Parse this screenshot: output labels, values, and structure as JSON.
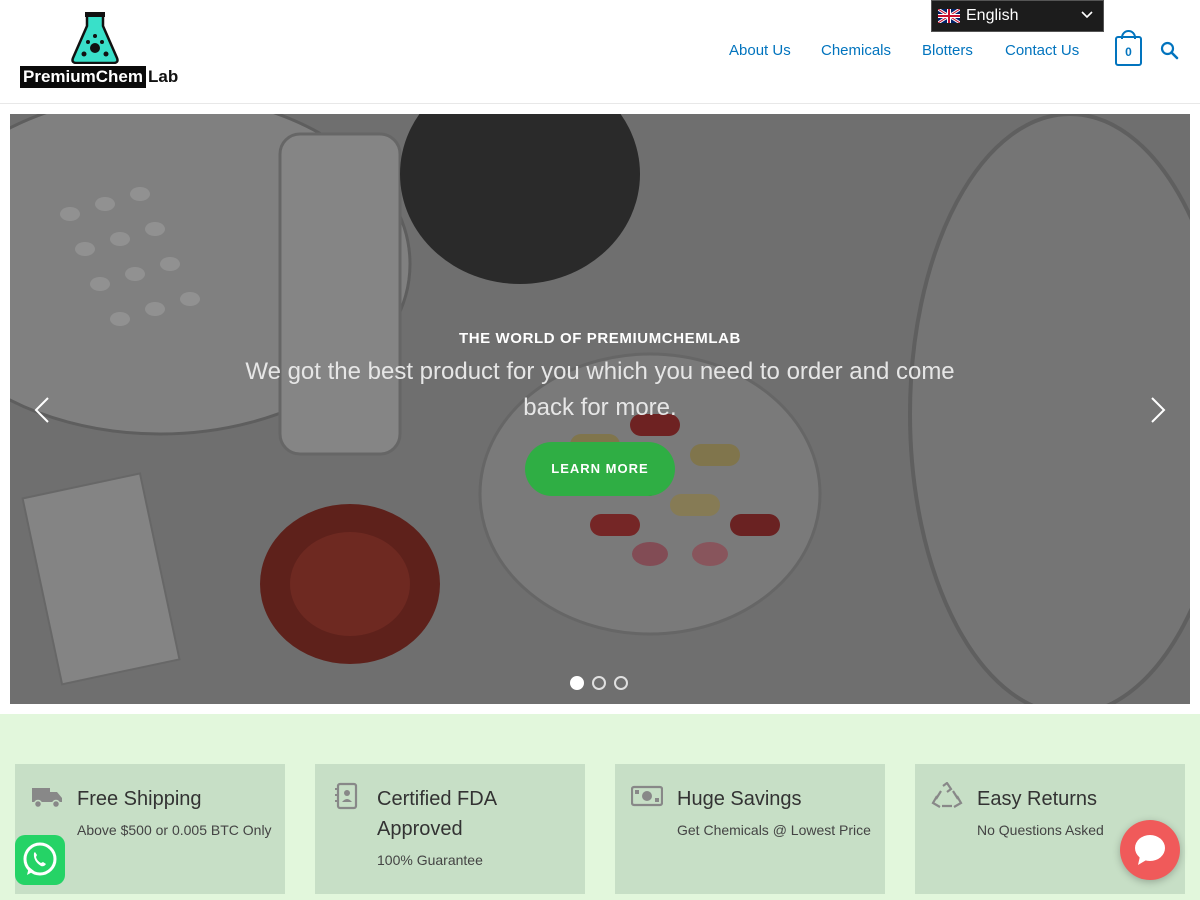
{
  "header": {
    "logo": {
      "part1": "PremiumChem",
      "part2": "Lab"
    },
    "nav": [
      {
        "label": "About Us"
      },
      {
        "label": "Chemicals"
      },
      {
        "label": "Blotters"
      },
      {
        "label": "Contact Us"
      }
    ],
    "language": "English",
    "cart_count": "0",
    "icons": {
      "search": "search-icon",
      "cart": "cart-icon",
      "flag": "uk-flag-icon"
    },
    "link_color": "#0274be"
  },
  "hero": {
    "kicker": "THE WORLD OF PREMIUMCHEMLAB",
    "text": "We got the best product for you which you need to order and come back for more.",
    "button": "LEARN MORE",
    "button_color": "#2fae44",
    "slides": 3,
    "active_slide": 1
  },
  "features": [
    {
      "icon": "truck-icon",
      "title": "Free Shipping",
      "subtitle": "Above $500 or 0.005 BTC Only"
    },
    {
      "icon": "certificate-icon",
      "title": "Certified FDA Approved",
      "subtitle": "100% Guarantee"
    },
    {
      "icon": "money-icon",
      "title": "Huge Savings",
      "subtitle": "Get Chemicals @ Lowest Price"
    },
    {
      "icon": "recycle-icon",
      "title": "Easy Returns",
      "subtitle": "No Questions Asked"
    }
  ],
  "widgets": {
    "whatsapp": "whatsapp-icon",
    "chat": "chat-bubble-icon"
  }
}
